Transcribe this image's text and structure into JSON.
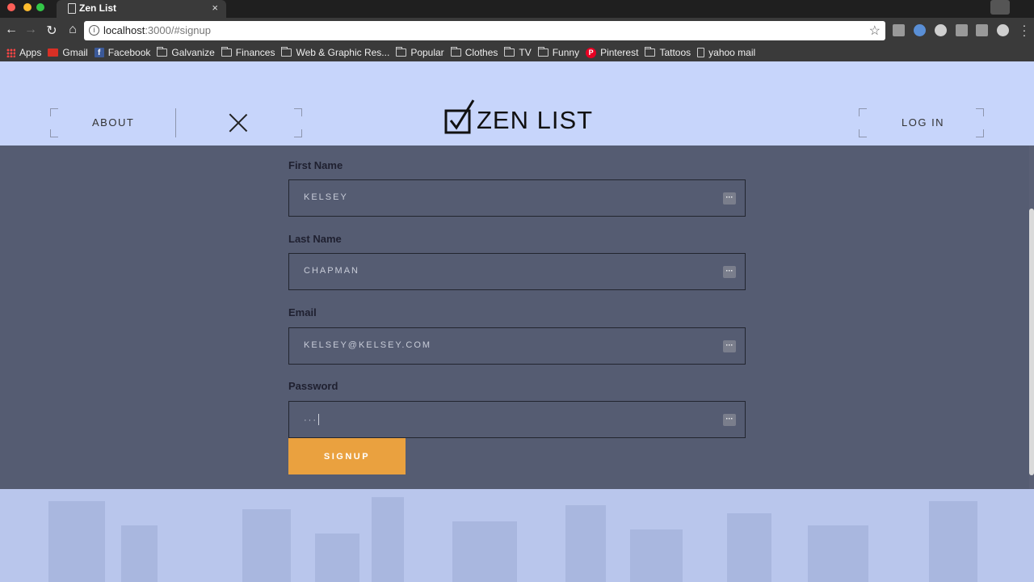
{
  "browser": {
    "tab_title": "Zen List",
    "tab_close": "×",
    "url_host": "localhost",
    "url_rest": ":3000/#signup",
    "bookmarks": [
      {
        "label": "Apps",
        "icon": "apps-icon"
      },
      {
        "label": "Gmail",
        "icon": "gmail-icon"
      },
      {
        "label": "Facebook",
        "icon": "facebook-icon"
      },
      {
        "label": "Galvanize",
        "icon": "folder-icon"
      },
      {
        "label": "Finances",
        "icon": "folder-icon"
      },
      {
        "label": "Web & Graphic Res...",
        "icon": "folder-icon"
      },
      {
        "label": "Popular",
        "icon": "folder-icon"
      },
      {
        "label": "Clothes",
        "icon": "folder-icon"
      },
      {
        "label": "TV",
        "icon": "folder-icon"
      },
      {
        "label": "Funny",
        "icon": "folder-icon"
      },
      {
        "label": "Pinterest",
        "icon": "pinterest-icon"
      },
      {
        "label": "Tattoos",
        "icon": "folder-icon"
      },
      {
        "label": "yahoo mail",
        "icon": "document-icon"
      }
    ]
  },
  "header": {
    "about": "ABOUT",
    "login": "LOG IN",
    "logo_text": "ZEN LIST"
  },
  "form": {
    "first_name_label": "First Name",
    "first_name_value": "KELSEY",
    "last_name_label": "Last Name",
    "last_name_value": "CHAPMAN",
    "email_label": "Email",
    "email_value": "KELSEY@KELSEY.COM",
    "password_label": "Password",
    "password_value": "···",
    "submit_label": "SIGNUP"
  },
  "colors": {
    "header_bg": "#c7d5fb",
    "panel_bg": "#555c72",
    "button": "#eaa13f"
  }
}
